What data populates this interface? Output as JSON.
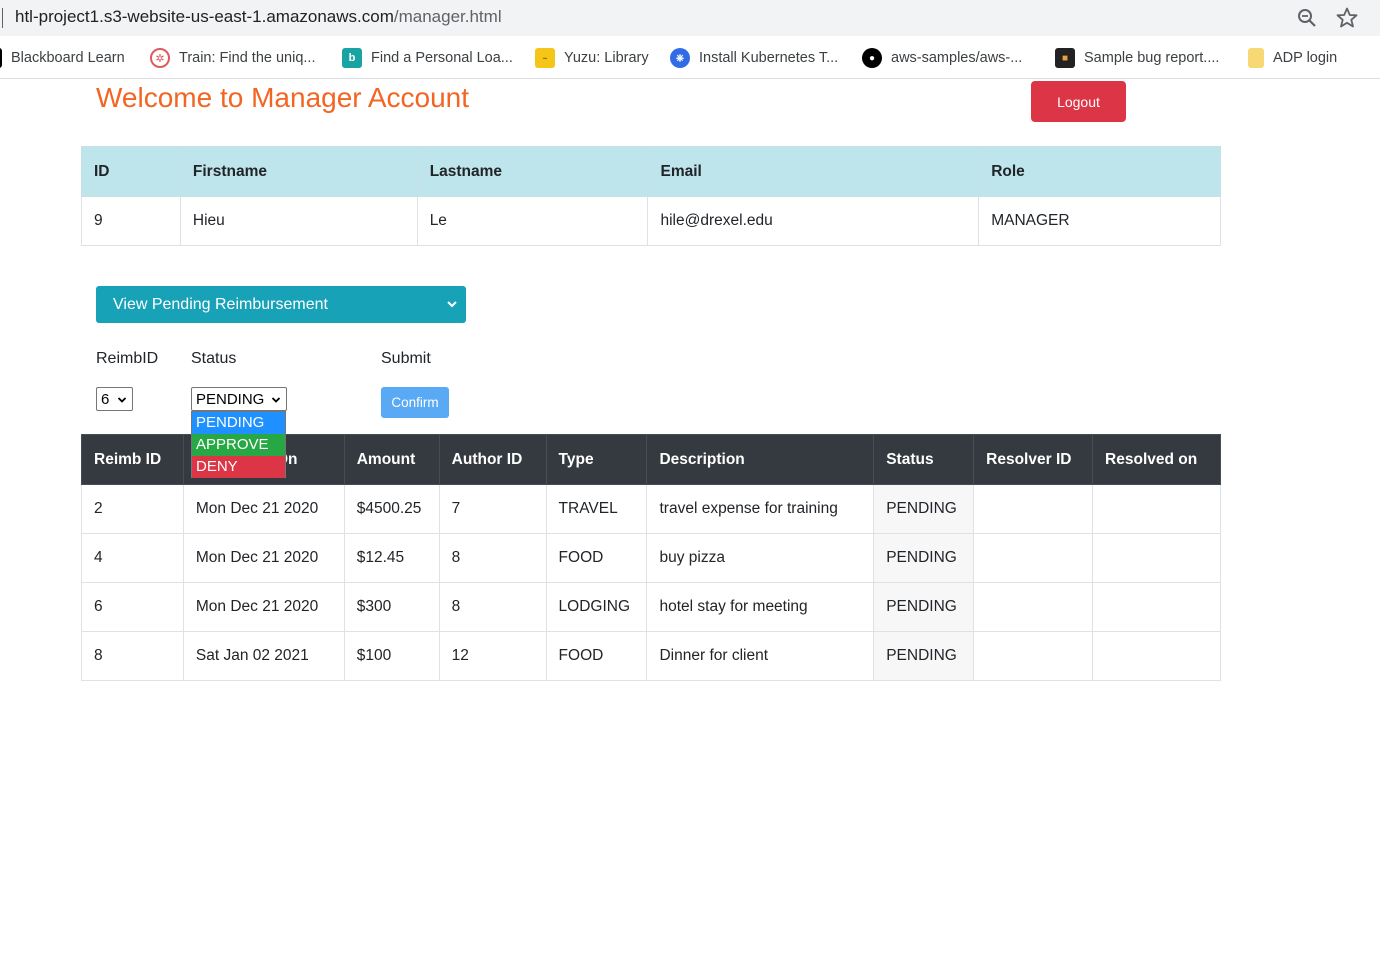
{
  "browser": {
    "url_host": "htl-project1.s3-website-us-east-1.amazonaws.com",
    "url_path": "/manager.html",
    "bookmarks": [
      {
        "label": "Blackboard Learn",
        "icon": "blackboard-icon",
        "color": "#000000"
      },
      {
        "label": "Train: Find the uniq...",
        "icon": "openai-icon",
        "color": "#e05a5a"
      },
      {
        "label": "Find a Personal Loa...",
        "icon": "bookmark-b-icon",
        "color": "#1aa3a3"
      },
      {
        "label": "Yuzu: Library",
        "icon": "yuzu-icon",
        "color": "#f5c518"
      },
      {
        "label": "Install Kubernetes T...",
        "icon": "kubernetes-icon",
        "color": "#326ce5"
      },
      {
        "label": "aws-samples/aws-...",
        "icon": "github-icon",
        "color": "#000000"
      },
      {
        "label": "Sample bug report....",
        "icon": "bug-report-icon",
        "color": "#222222"
      },
      {
        "label": "ADP login",
        "icon": "folder-icon",
        "color": "#f8d775"
      }
    ]
  },
  "header": {
    "title": "Welcome to Manager Account",
    "logout_label": "Logout"
  },
  "user_table": {
    "headers": [
      "ID",
      "Firstname",
      "Lastname",
      "Email",
      "Role"
    ],
    "row": [
      "9",
      "Hieu",
      "Le",
      "hile@drexel.edu",
      "MANAGER"
    ]
  },
  "view_select": {
    "selected": "View Pending Reimbursement"
  },
  "form": {
    "reimb_label": "ReimbID",
    "status_label": "Status",
    "submit_label": "Submit",
    "reimb_value": "6",
    "status_value": "PENDING",
    "confirm_label": "Confirm",
    "status_options": [
      {
        "label": "PENDING",
        "color": "#1e90ff"
      },
      {
        "label": "APPROVE",
        "color": "#28a745"
      },
      {
        "label": "DENY",
        "color": "#dc3545"
      }
    ]
  },
  "reimb_table": {
    "headers": [
      "Reimb ID",
      "Submitted On",
      "Amount",
      "Author ID",
      "Type",
      "Description",
      "Status",
      "Resolver ID",
      "Resolved on"
    ],
    "rows": [
      [
        "2",
        "Mon Dec 21 2020",
        "$4500.25",
        "7",
        "TRAVEL",
        "travel expense for training",
        "PENDING",
        "",
        ""
      ],
      [
        "4",
        "Mon Dec 21 2020",
        "$12.45",
        "8",
        "FOOD",
        "buy pizza",
        "PENDING",
        "",
        ""
      ],
      [
        "6",
        "Mon Dec 21 2020",
        "$300",
        "8",
        "LODGING",
        "hotel stay for meeting",
        "PENDING",
        "",
        ""
      ],
      [
        "8",
        "Sat Jan 02 2021",
        "$100",
        "12",
        "FOOD",
        "Dinner for client",
        "PENDING",
        "",
        ""
      ]
    ]
  }
}
